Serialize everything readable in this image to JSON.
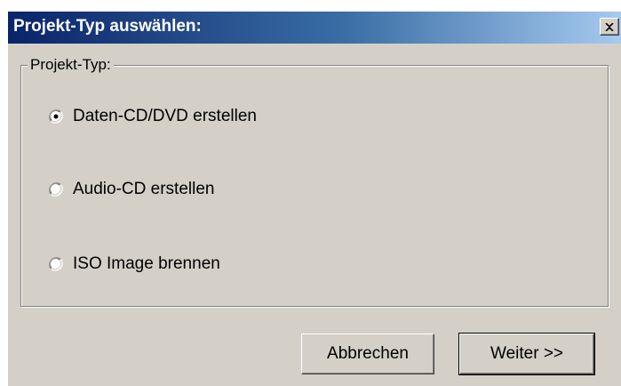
{
  "window": {
    "title": "Projekt-Typ auswählen:",
    "close_label": "X"
  },
  "group": {
    "legend": "Projekt-Typ:"
  },
  "options": [
    {
      "label": "Daten-CD/DVD erstellen",
      "selected": true
    },
    {
      "label": "Audio-CD erstellen",
      "selected": false
    },
    {
      "label": "ISO Image brennen",
      "selected": false
    }
  ],
  "buttons": {
    "cancel_label": "Abbrechen",
    "next_label": "Weiter >>"
  },
  "colors": {
    "titlebar_start": "#0a246a",
    "titlebar_end": "#a6caf0",
    "dialog_face": "#d4d0c8"
  }
}
